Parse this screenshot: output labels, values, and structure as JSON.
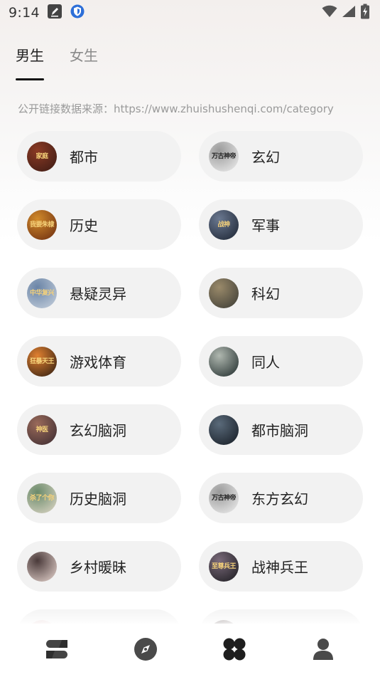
{
  "status": {
    "time": "9:14",
    "icons": [
      "edit-notification-icon",
      "shield-notification-icon",
      "wifi-icon",
      "cell-signal-icon",
      "battery-icon"
    ]
  },
  "tabs": [
    {
      "label": "男生",
      "active": true
    },
    {
      "label": "女生",
      "active": false
    }
  ],
  "source_text": "公开链接数据来源：https://www.zhuishushenqi.com/category",
  "categories": [
    {
      "label": "都市",
      "cover_text": "家庭",
      "cover_colors": [
        "#3a1a14",
        "#8b3a24"
      ]
    },
    {
      "label": "玄幻",
      "cover_text": "万古神帝",
      "cover_colors": [
        "#f0f0f0",
        "#9a9a9a"
      ]
    },
    {
      "label": "历史",
      "cover_text": "我要朱棣",
      "cover_colors": [
        "#6a2a10",
        "#d18a2a"
      ]
    },
    {
      "label": "军事",
      "cover_text": "战神",
      "cover_colors": [
        "#1a2230",
        "#6a7890"
      ]
    },
    {
      "label": "悬疑灵异",
      "cover_text": "中华复兴",
      "cover_colors": [
        "#c8d2de",
        "#6a84a6"
      ]
    },
    {
      "label": "科幻",
      "cover_text": "",
      "cover_colors": [
        "#3a3a34",
        "#9a8a6a"
      ]
    },
    {
      "label": "游戏体育",
      "cover_text": "狂暴天王",
      "cover_colors": [
        "#2a1a10",
        "#e08030"
      ]
    },
    {
      "label": "同人",
      "cover_text": "",
      "cover_colors": [
        "#1e2a2a",
        "#b0b8b0"
      ]
    },
    {
      "label": "玄幻脑洞",
      "cover_text": "神医",
      "cover_colors": [
        "#3a2a30",
        "#9a6a5a"
      ]
    },
    {
      "label": "都市脑洞",
      "cover_text": "",
      "cover_colors": [
        "#141a22",
        "#5a6a7a"
      ]
    },
    {
      "label": "历史脑洞",
      "cover_text": "杀了个你",
      "cover_colors": [
        "#e0d8c8",
        "#6a8a6a"
      ]
    },
    {
      "label": "东方玄幻",
      "cover_text": "万古神帝",
      "cover_colors": [
        "#f0f0f0",
        "#9a9a9a"
      ]
    },
    {
      "label": "乡村暖昧",
      "cover_text": "",
      "cover_colors": [
        "#e8d6d0",
        "#4a3a3a"
      ]
    },
    {
      "label": "战神兵王",
      "cover_text": "至尊兵王",
      "cover_colors": [
        "#1a1a1e",
        "#7a6a7a"
      ]
    },
    {
      "label": "",
      "cover_text": "",
      "cover_colors": [
        "#f2f2f2",
        "#e0c0c0"
      ]
    },
    {
      "label": "",
      "cover_text": "",
      "cover_colors": [
        "#f2f2f2",
        "#3a2a2a"
      ]
    }
  ],
  "nav": [
    {
      "icon": "bookshelf-icon",
      "active": false
    },
    {
      "icon": "compass-icon",
      "active": false
    },
    {
      "icon": "category-grid-icon",
      "active": true
    },
    {
      "icon": "profile-icon",
      "active": false
    }
  ]
}
